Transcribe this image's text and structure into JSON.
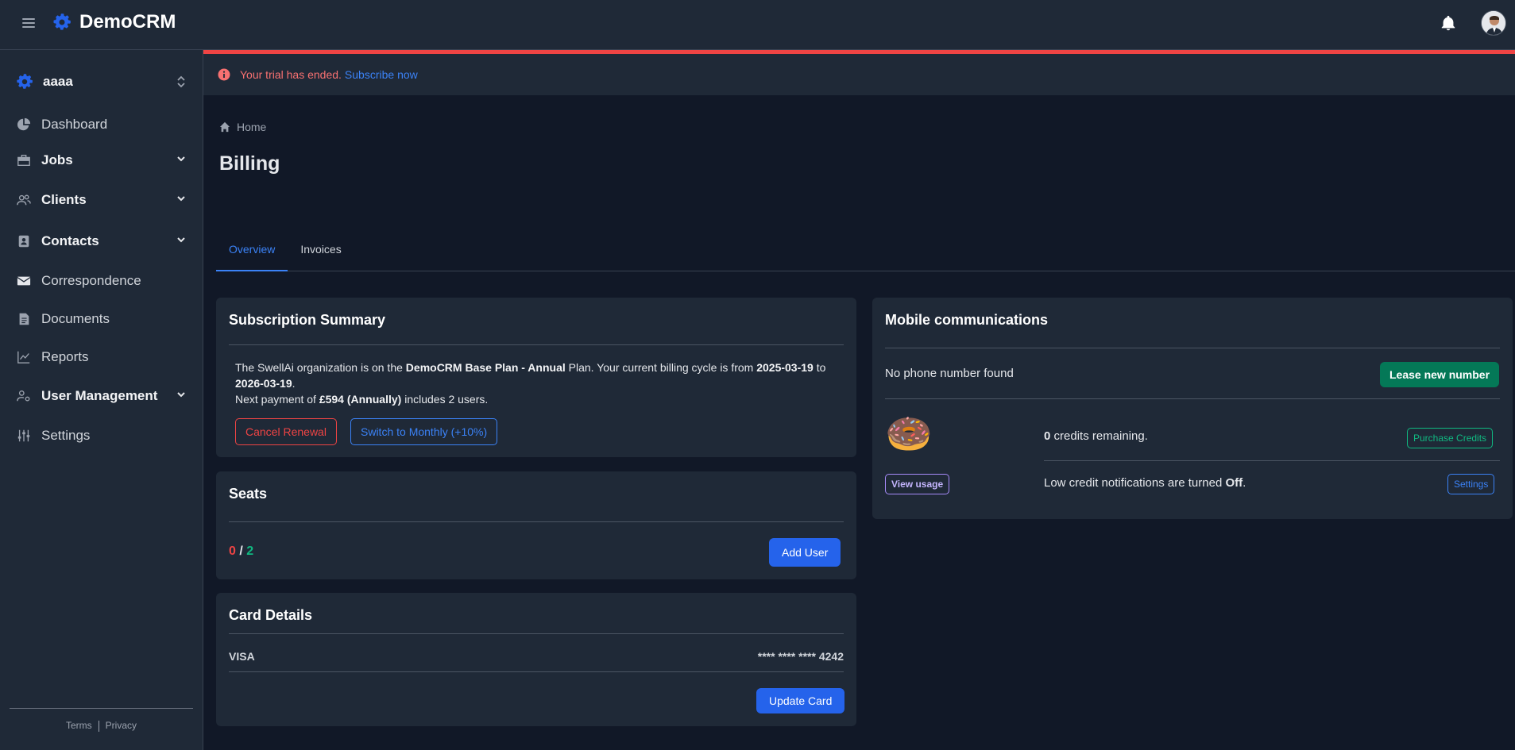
{
  "app": {
    "name": "DemoCRM"
  },
  "sidebar": {
    "org_name": "aaaa",
    "items": [
      {
        "label": "Dashboard"
      },
      {
        "label": "Jobs"
      },
      {
        "label": "Clients"
      },
      {
        "label": "Contacts"
      },
      {
        "label": "Correspondence"
      },
      {
        "label": "Documents"
      },
      {
        "label": "Reports"
      },
      {
        "label": "User Management"
      },
      {
        "label": "Settings"
      }
    ],
    "footer": {
      "terms": "Terms",
      "privacy": "Privacy"
    }
  },
  "banner": {
    "text": "Your trial has ended.",
    "link": "Subscribe now"
  },
  "breadcrumb": {
    "home": "Home"
  },
  "page": {
    "title": "Billing"
  },
  "tabs": [
    {
      "label": "Overview"
    },
    {
      "label": "Invoices"
    }
  ],
  "subscription": {
    "title": "Subscription Summary",
    "text_1": "The SwellAi organization is on the ",
    "plan": "DemoCRM Base Plan - Annual",
    "text_2": " Plan. Your current billing cycle is from ",
    "start": "2025-03-19",
    "text_3": " to ",
    "end": "2026-03-19",
    "text_4": ".",
    "next_text": "Next payment of ",
    "amount": "£594 (Annually)",
    "users_text": " includes 2 users.",
    "cancel_button": "Cancel Renewal",
    "switch_button": "Switch to Monthly (+10%)"
  },
  "seats": {
    "title": "Seats",
    "used": "0",
    "sep": "/",
    "total": "2",
    "add_button": "Add User"
  },
  "card_details": {
    "title": "Card Details",
    "brand": "VISA",
    "masked": "**** **** ****",
    "last4": "4242",
    "update_button": "Update Card"
  },
  "mobile": {
    "title": "Mobile communications",
    "no_phone": "No phone number found",
    "lease_button": "Lease new number",
    "credits_count": "0",
    "credits_text": " credits remaining.",
    "purchase_button": "Purchase Credits",
    "view_usage_button": "View usage",
    "notif_text": "Low credit notifications are turned ",
    "notif_state": "Off",
    "notif_end": ".",
    "settings_button": "Settings",
    "emoji": "🍩"
  },
  "colors": {
    "accent": "#3b82f6",
    "danger": "#ef4444",
    "success": "#10b981",
    "primary_button": "#2563eb",
    "green_button": "#047857"
  }
}
